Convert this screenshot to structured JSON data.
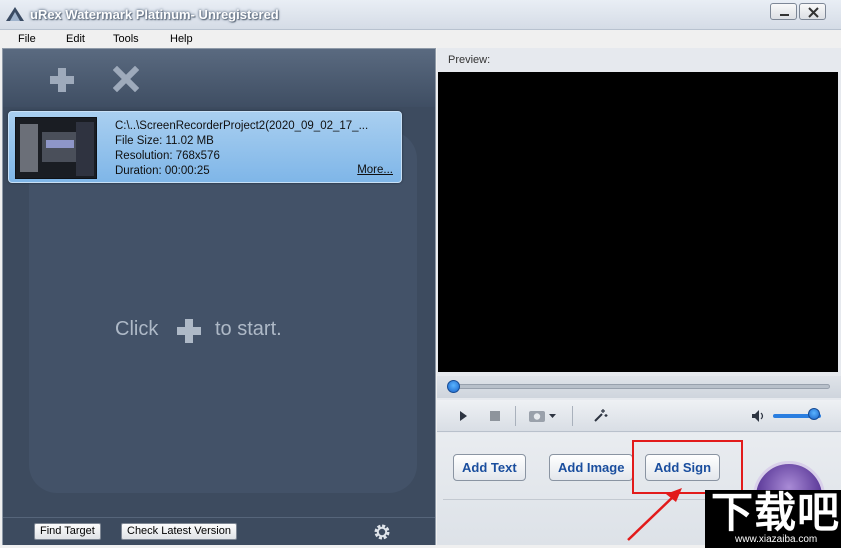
{
  "window": {
    "title": "uRex Watermark Platinum- Unregistered"
  },
  "menu": [
    "File",
    "Edit",
    "Tools",
    "Help"
  ],
  "file_item": {
    "path": "C:\\..\\ScreenRecorderProject2(2020_09_02_17_...",
    "size": "File Size: 11.02 MB",
    "resolution": "Resolution: 768x576",
    "duration": "Duration: 00:00:25",
    "more": "More..."
  },
  "hint": {
    "before": "Click",
    "after": "to start."
  },
  "bottom": {
    "find_target": "Find Target",
    "check_version": "Check Latest Version"
  },
  "preview": {
    "label": "Preview:",
    "progress": 0.0,
    "volume": 0.85
  },
  "actions": {
    "add_text": "Add Text",
    "add_image": "Add Image",
    "add_sign": "Add Sign"
  },
  "watermark": {
    "text": "下载吧",
    "url": "www.xiazaiba.com"
  },
  "colors": {
    "accent": "#1a4e9e",
    "highlight": "#e21b1b",
    "panel_dark": "#3d4b5f"
  }
}
